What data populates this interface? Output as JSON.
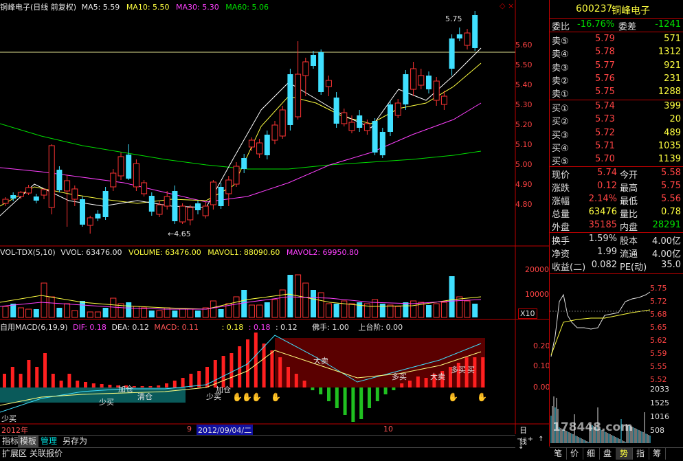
{
  "chart_header": {
    "title": "铜峰电子(日线 前复权)",
    "ma5": "MA5: 5.59",
    "ma10": "MA10: 5.50",
    "ma30": "MA30: 5.30",
    "ma60": "MA60: 5.06",
    "max_label": "5.75",
    "min_label": "4.65"
  },
  "price_axis": [
    "5.60",
    "5.50",
    "5.40",
    "5.30",
    "5.20",
    "5.10",
    "5.00",
    "4.90",
    "4.80"
  ],
  "vol_header": {
    "name": "VOL-TDX(5,10)",
    "vvol": "VVOL: 63476.00",
    "volume": "VOLUME: 63476.00",
    "mavol1": "MAVOL1: 88090.60",
    "mavol2": "MAVOL2: 69950.80"
  },
  "vol_axis": [
    "20000",
    "10000"
  ],
  "vol_unit": "X10",
  "macd_header": {
    "name": "自用MACD(6,19,9)",
    "dif": "DIF: 0.18",
    "dea": "DEA: 0.12",
    "macd": "MACD: 0.11",
    "v1": ": 0.18",
    "v2": ": 0.18",
    "v3": ": 0.12",
    "fomo": "佛手: 1.00",
    "stair": "上台阶: 0.00"
  },
  "macd_axis": [
    "0.20",
    "0.10",
    "0.00"
  ],
  "macd_annotations": [
    "少买",
    "少买",
    "加仓",
    "清仓",
    "少买",
    "加仓",
    "大卖",
    "多买",
    "大卖",
    "多买",
    "买"
  ],
  "date_axis": {
    "left": "2012年",
    "mid": "9",
    "highlight": "2012/09/04/二",
    "right": "10",
    "period": "日线"
  },
  "left_tabs": [
    "指标",
    "模板",
    "管理",
    "另存为"
  ],
  "left_tabs2": [
    "扩展区",
    "关联报价"
  ],
  "stock": {
    "code": "600237",
    "name": "铜峰电子"
  },
  "weibi": {
    "label1": "委比",
    "value1": "-16.76%",
    "label2": "委差",
    "value2": "-1241"
  },
  "sell_orders": [
    {
      "label": "卖⑤",
      "price": "5.79",
      "volume": "571"
    },
    {
      "label": "卖④",
      "price": "5.78",
      "volume": "1312"
    },
    {
      "label": "卖③",
      "price": "5.77",
      "volume": "921"
    },
    {
      "label": "卖②",
      "price": "5.76",
      "volume": "231"
    },
    {
      "label": "卖①",
      "price": "5.75",
      "volume": "1288"
    }
  ],
  "buy_orders": [
    {
      "label": "买①",
      "price": "5.74",
      "volume": "399"
    },
    {
      "label": "买②",
      "price": "5.73",
      "volume": "20"
    },
    {
      "label": "买③",
      "price": "5.72",
      "volume": "489"
    },
    {
      "label": "买④",
      "price": "5.71",
      "volume": "1035"
    },
    {
      "label": "买⑤",
      "price": "5.70",
      "volume": "1139"
    }
  ],
  "quote": [
    {
      "l1": "现价",
      "v1": "5.74",
      "l2": "今开",
      "v2": "5.58"
    },
    {
      "l1": "涨跌",
      "v1": "0.12",
      "l2": "最高",
      "v2": "5.75"
    },
    {
      "l1": "涨幅",
      "v1": "2.14%",
      "l2": "最低",
      "v2": "5.56"
    },
    {
      "l1": "总量",
      "v1": "63476",
      "l2": "量比",
      "v2": "0.78"
    },
    {
      "l1": "外盘",
      "v1": "35185",
      "l2": "内盘",
      "v2": "28291"
    }
  ],
  "stats": [
    {
      "l1": "换手",
      "v1": "1.59%",
      "l2": "股本",
      "v2": "4.00亿"
    },
    {
      "l1": "净资",
      "v1": "1.99",
      "l2": "流通",
      "v2": "4.00亿"
    },
    {
      "l1": "收益(二)",
      "v1": "0.082",
      "l2": "PE(动)",
      "v2": "35.0"
    }
  ],
  "intraday_axis": [
    "5.75",
    "5.72",
    "5.68",
    "5.65",
    "5.62",
    "5.59",
    "5.55",
    "5.52"
  ],
  "intraday_vol_axis": [
    "2033",
    "1525",
    "1016",
    "508"
  ],
  "watermark": "178448.com",
  "bottom_tabs": [
    "笔",
    "价",
    "细",
    "盘",
    "势",
    "指",
    "筹"
  ],
  "colors": {
    "up": "#ff3333",
    "down": "#40e0ff",
    "ma5": "#ffffff",
    "ma10": "#ffff40",
    "ma30": "#ff40ff",
    "ma60": "#00e000"
  }
}
